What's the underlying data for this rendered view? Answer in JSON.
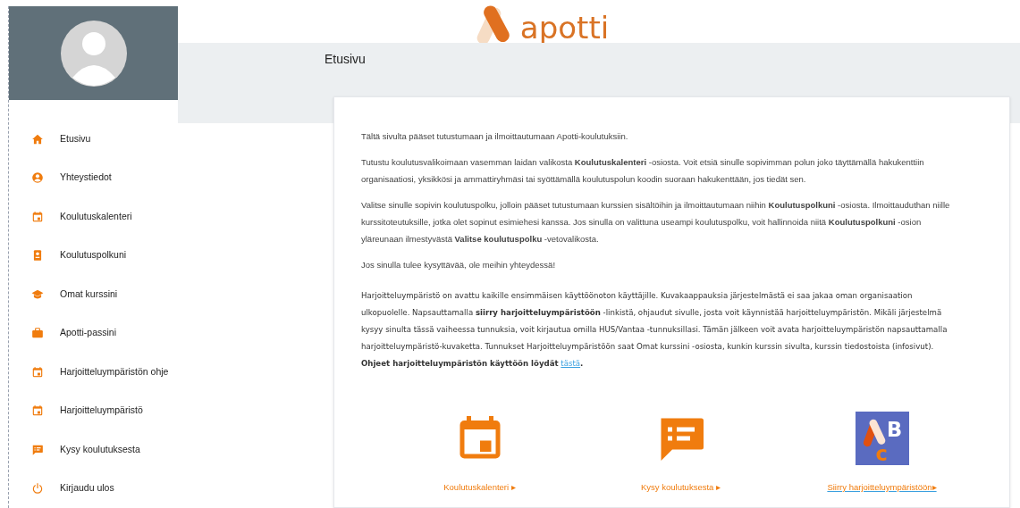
{
  "logo": {
    "text": "apotti"
  },
  "page_title": "Etusivu",
  "sidebar": {
    "items": [
      {
        "label": "Etusivu"
      },
      {
        "label": "Yhteystiedot"
      },
      {
        "label": "Koulutuskalenteri"
      },
      {
        "label": "Koulutuspolkuni"
      },
      {
        "label": "Omat kurssini"
      },
      {
        "label": "Apotti-passini"
      },
      {
        "label": "Harjoitteluympäristön ohje"
      },
      {
        "label": "Harjoitteluympäristö"
      },
      {
        "label": "Kysy koulutuksesta"
      },
      {
        "label": "Kirjaudu ulos"
      }
    ]
  },
  "content": {
    "paragraphs": [
      {
        "kind": "plain",
        "text": "Tältä sivulta pääset tutustumaan ja ilmoittautumaan Apotti-koulutuksiin."
      },
      {
        "kind": "plain",
        "text": "Tutustu koulutusvalikoimaan vasemman laidan valikosta **Koulutuskalenteri** -osiosta. Voit etsiä sinulle sopivimman polun joko täyttämällä hakukenttiin organisaatiosi, yksikkösi ja ammattiryhmäsi tai syöttämällä koulutuspolun koodin suoraan hakukenttään, jos tiedät sen."
      },
      {
        "kind": "plain",
        "text": "Valitse sinulle sopivin koulutuspolku, jolloin pääset tutustumaan kurssien sisältöihin ja ilmoittautumaan niihin **Koulutuspolkuni** -osiosta. Ilmoittauduthan niille kurssitoteutuksille, jotka olet sopinut esimiehesi kanssa. Jos sinulla on valittuna useampi koulutuspolku, voit hallinnoida niitä **Koulutuspolkuni** -osion yläreunaan ilmestyvästä **Valitse koulutuspolku** -vetovalikosta."
      },
      {
        "kind": "plain",
        "text": "Jos sinulla tulee kysyttävää, ole meihin yhteydessä!"
      },
      {
        "kind": "alt",
        "text": "Harjoitteluympäristö on avattu kaikille ensimmäisen käyttöönoton käyttäjille. Kuvakaappauksia järjestelmästä ei saa jakaa oman organisaation ulkopuolelle. Napsauttamalla **siirry harjoitteluympäristöön** -linkistä, ohjaudut sivulle, josta voit käynnistää harjoitteluympäristön. Mikäli järjestelmä kysyy sinulta tässä vaiheessa tunnuksia, voit kirjautua omilla HUS/Vantaa -tunnuksillasi. Tämän jälkeen voit avata harjoitteluympäristön napsauttamalla harjoitteluympäristö-kuvaketta. Tunnukset Harjoitteluympäristöön saat Omat kurssini -osiosta, kunkin kurssin sivulta, kurssin tiedostoista (infosivut). **Ohjeet harjoitteluympäristön käyttöön löydät** ",
        "link": "tästä",
        "after": "**.**"
      }
    ],
    "shortcuts": [
      {
        "label": "Koulutuskalenteri ▸",
        "underlined": false
      },
      {
        "label": "Kysy koulutuksesta ▸",
        "underlined": false
      },
      {
        "label": "Siirry harjoitteluympäristöön▸",
        "underlined": true,
        "icon_letters": [
          "B",
          "c"
        ]
      }
    ]
  }
}
